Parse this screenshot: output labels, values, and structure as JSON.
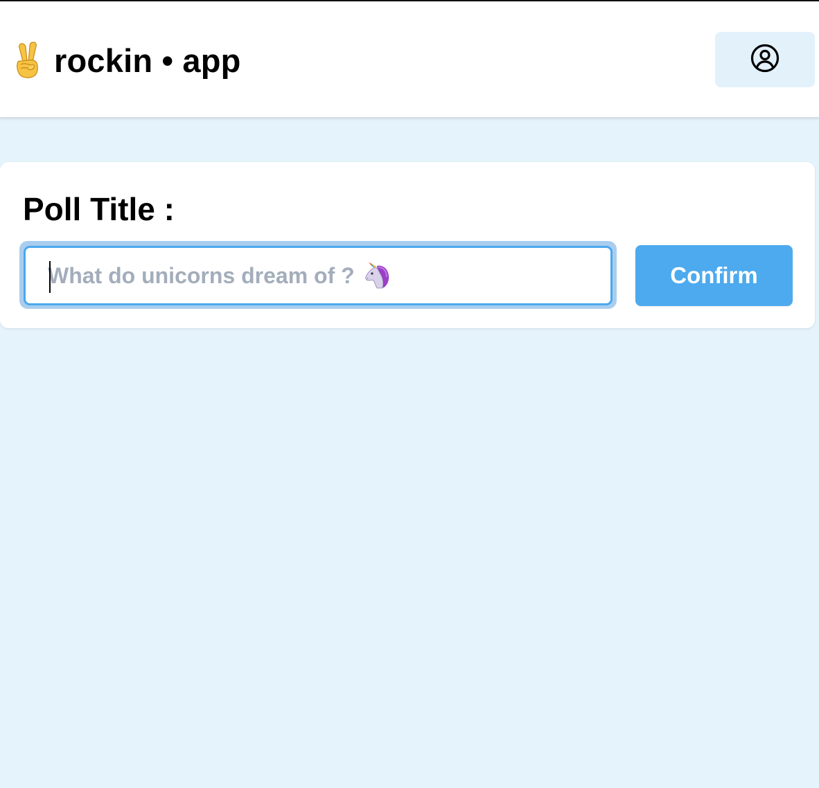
{
  "header": {
    "brand_text": "rockin • app",
    "brand_icon": "victory-hand-emoji",
    "account_icon": "user-circle-icon"
  },
  "poll": {
    "title_label": "Poll Title :",
    "input_placeholder": "What do unicorns dream of ?",
    "input_emoji": "unicorn-emoji",
    "confirm_label": "Confirm"
  },
  "colors": {
    "page_background": "#e5f3fc",
    "accent": "#4daaee",
    "account_button_bg": "#e3f1fb",
    "placeholder_text": "#a3adbb"
  }
}
